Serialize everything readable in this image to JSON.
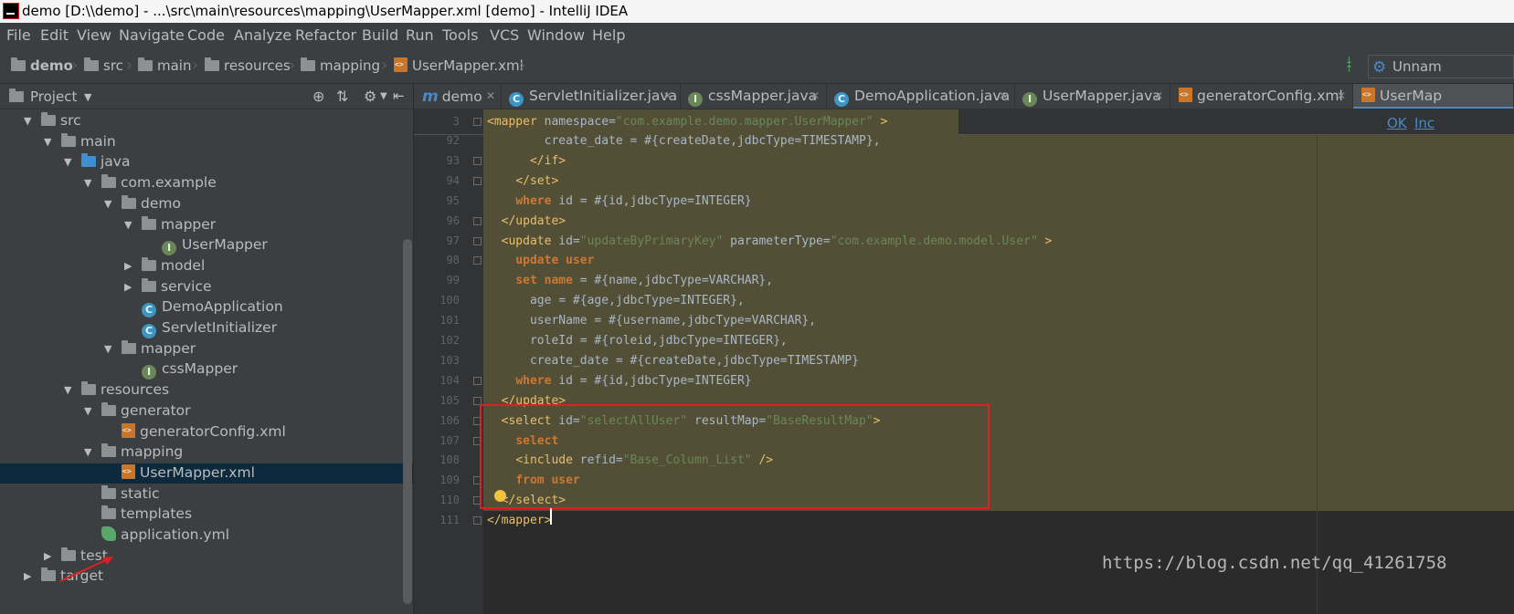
{
  "window": {
    "title": "demo [D:\\\\demo] - ...\\src\\main\\resources\\mapping\\UserMapper.xml [demo] - IntelliJ IDEA"
  },
  "menu": [
    "File",
    "Edit",
    "View",
    "Navigate",
    "Code",
    "Analyze",
    "Refactor",
    "Build",
    "Run",
    "Tools",
    "VCS",
    "Window",
    "Help"
  ],
  "breadcrumb": {
    "project": "demo",
    "items": [
      "src",
      "main",
      "resources",
      "mapping",
      "UserMapper.xml"
    ]
  },
  "run_config": {
    "label": "Unnam"
  },
  "project_panel": {
    "title": "Project"
  },
  "tree": [
    {
      "label": "src",
      "arrow": "▼",
      "icon": "folder"
    },
    {
      "label": "main",
      "arrow": "▼",
      "icon": "folder"
    },
    {
      "label": "java",
      "arrow": "▼",
      "icon": "folder-blue"
    },
    {
      "label": "com.example",
      "arrow": "▼",
      "icon": "folder"
    },
    {
      "label": "demo",
      "arrow": "▼",
      "icon": "folder"
    },
    {
      "label": "mapper",
      "arrow": "▼",
      "icon": "folder"
    },
    {
      "label": "UserMapper",
      "arrow": "",
      "icon": "interface"
    },
    {
      "label": "model",
      "arrow": "▶",
      "icon": "folder"
    },
    {
      "label": "service",
      "arrow": "▶",
      "icon": "folder"
    },
    {
      "label": "DemoApplication",
      "arrow": "",
      "icon": "class"
    },
    {
      "label": "ServletInitializer",
      "arrow": "",
      "icon": "class"
    },
    {
      "label": "mapper",
      "arrow": "▼",
      "icon": "folder"
    },
    {
      "label": "cssMapper",
      "arrow": "",
      "icon": "interface"
    },
    {
      "label": "resources",
      "arrow": "▼",
      "icon": "folder"
    },
    {
      "label": "generator",
      "arrow": "▼",
      "icon": "folder"
    },
    {
      "label": "generatorConfig.xml",
      "arrow": "",
      "icon": "xml"
    },
    {
      "label": "mapping",
      "arrow": "▼",
      "icon": "folder"
    },
    {
      "label": "UserMapper.xml",
      "arrow": "",
      "icon": "xml",
      "selected": true
    },
    {
      "label": "static",
      "arrow": "",
      "icon": "folder"
    },
    {
      "label": "templates",
      "arrow": "",
      "icon": "folder"
    },
    {
      "label": "application.yml",
      "arrow": "",
      "icon": "yml"
    },
    {
      "label": "test",
      "arrow": "▶",
      "icon": "folder"
    },
    {
      "label": "target",
      "arrow": "▶",
      "icon": "folder"
    }
  ],
  "tabs": [
    "demo",
    "ServletInitializer.java",
    "cssMapper.java",
    "DemoApplication.java",
    "UserMapper.java",
    "generatorConfig.xml",
    "UserMap"
  ],
  "sticky": {
    "line": "3",
    "text": "<mapper namespace=\"com.example.demo.mapper.UserMapper\" >",
    "actions": [
      "OK",
      "Inc"
    ]
  },
  "code": [
    {
      "n": "92",
      "t": "        create_date = #{createDate,jdbcType=TIMESTAMP},"
    },
    {
      "n": "93",
      "t": "      </if>"
    },
    {
      "n": "94",
      "t": "    </set>"
    },
    {
      "n": "95",
      "t": "    where id = #{id,jdbcType=INTEGER}"
    },
    {
      "n": "96",
      "t": "  </update>"
    },
    {
      "n": "97",
      "t": "  <update id=\"updateByPrimaryKey\" parameterType=\"com.example.demo.model.User\" >"
    },
    {
      "n": "98",
      "t": "    update user"
    },
    {
      "n": "99",
      "t": "    set name = #{name,jdbcType=VARCHAR},"
    },
    {
      "n": "100",
      "t": "      age = #{age,jdbcType=INTEGER},"
    },
    {
      "n": "101",
      "t": "      userName = #{username,jdbcType=VARCHAR},"
    },
    {
      "n": "102",
      "t": "      roleId = #{roleid,jdbcType=INTEGER},"
    },
    {
      "n": "103",
      "t": "      create_date = #{createDate,jdbcType=TIMESTAMP}"
    },
    {
      "n": "104",
      "t": "    where id = #{id,jdbcType=INTEGER}"
    },
    {
      "n": "105",
      "t": "  </update>"
    },
    {
      "n": "106",
      "t": "  <select id=\"selectAllUser\" resultMap=\"BaseResultMap\">"
    },
    {
      "n": "107",
      "t": "    select"
    },
    {
      "n": "108",
      "t": "    <include refid=\"Base_Column_List\" />"
    },
    {
      "n": "109",
      "t": "    from user"
    },
    {
      "n": "110",
      "t": "  </select>"
    },
    {
      "n": "111",
      "t": "</mapper>"
    }
  ],
  "watermark": "https://blog.csdn.net/qq_41261758",
  "colors": {
    "background": "#2b2b2b",
    "panel": "#3c3f41",
    "highlight": "#524f36",
    "selection": "#0d293e",
    "annotation": "#e02020"
  }
}
